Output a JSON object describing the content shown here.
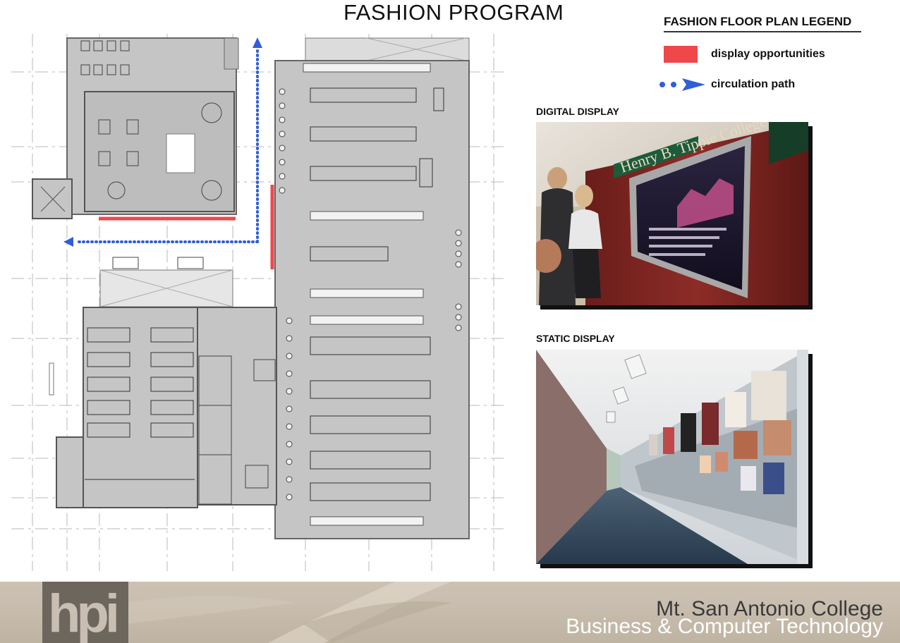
{
  "title": "FASHION PROGRAM",
  "legend": {
    "title": "FASHION FLOOR PLAN LEGEND",
    "items": [
      {
        "label": "display opportunities",
        "color": "#f0474b"
      },
      {
        "label": "circulation path",
        "color": "#2f5fd8"
      }
    ]
  },
  "photos": {
    "digital_label": "DIGITAL DISPLAY",
    "digital_sign_text": "Henry B. Tippie College of Bu",
    "static_label": "STATIC DISPLAY"
  },
  "footer": {
    "logo": "hpi",
    "line1": "Mt. San Antonio College",
    "line2": "Business & Computer Technology"
  },
  "colors": {
    "display_red": "#f0474b",
    "circulation_blue": "#2f5fd8",
    "plan_fill": "#c5c5c5"
  }
}
